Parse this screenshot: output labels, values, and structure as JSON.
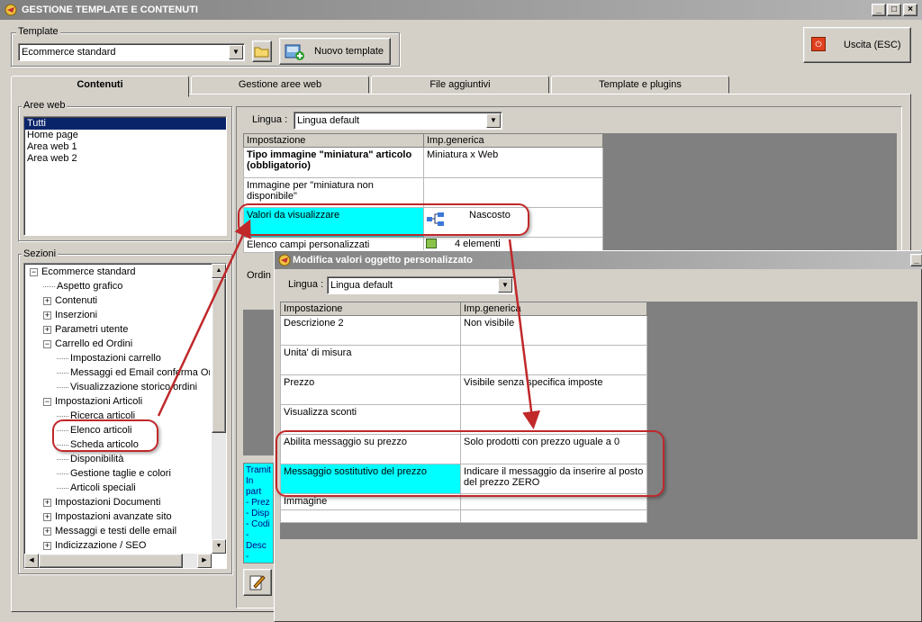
{
  "window": {
    "title": "GESTIONE TEMPLATE E CONTENUTI"
  },
  "template_group": {
    "label": "Template",
    "selected": "Ecommerce standard",
    "new_button": "Nuovo template"
  },
  "exit_button": "Uscita (ESC)",
  "tabs": [
    "Contenuti",
    "Gestione aree web",
    "File aggiuntivi",
    "Template e plugins"
  ],
  "aree_web": {
    "label": "Aree web",
    "items": [
      "Tutti",
      "Home page",
      "Area web 1",
      "Area web 2"
    ]
  },
  "sezioni": {
    "label": "Sezioni",
    "items": [
      {
        "text": "Ecommerce standard",
        "level": 0,
        "exp": "−"
      },
      {
        "text": "Aspetto grafico",
        "level": 1,
        "exp": ""
      },
      {
        "text": "Contenuti",
        "level": 1,
        "exp": "+"
      },
      {
        "text": "Inserzioni",
        "level": 1,
        "exp": "+"
      },
      {
        "text": "Parametri utente",
        "level": 1,
        "exp": "+"
      },
      {
        "text": "Carrello ed Ordini",
        "level": 1,
        "exp": "−"
      },
      {
        "text": "Impostazioni carrello",
        "level": 2,
        "exp": ""
      },
      {
        "text": "Messaggi ed Email conferma Ordini",
        "level": 2,
        "exp": ""
      },
      {
        "text": "Visualizzazione storico ordini",
        "level": 2,
        "exp": ""
      },
      {
        "text": "Impostazioni Articoli",
        "level": 1,
        "exp": "−"
      },
      {
        "text": "Ricerca articoli",
        "level": 2,
        "exp": ""
      },
      {
        "text": "Elenco articoli",
        "level": 2,
        "exp": ""
      },
      {
        "text": "Scheda articolo",
        "level": 2,
        "exp": ""
      },
      {
        "text": "Disponibilità",
        "level": 2,
        "exp": ""
      },
      {
        "text": "Gestione taglie e colori",
        "level": 2,
        "exp": ""
      },
      {
        "text": "Articoli speciali",
        "level": 2,
        "exp": ""
      },
      {
        "text": "Impostazioni Documenti",
        "level": 1,
        "exp": "+"
      },
      {
        "text": "Impostazioni avanzate sito",
        "level": 1,
        "exp": "+"
      },
      {
        "text": "Messaggi e testi delle email",
        "level": 1,
        "exp": "+"
      },
      {
        "text": "Indicizzazione / SEO",
        "level": 1,
        "exp": "+"
      }
    ]
  },
  "main": {
    "lingua_label": "Lingua :",
    "lingua_value": "Lingua default",
    "headers": [
      "Impostazione",
      "Imp.generica"
    ],
    "rows": [
      {
        "name": "Tipo immagine \"miniatura\" articolo (obbligatorio)",
        "value": "Miniatura x Web"
      },
      {
        "name": "Immagine per \"miniatura non disponibile\"",
        "value": ""
      },
      {
        "name": "Valori da visualizzare",
        "value": "Nascosto"
      },
      {
        "name": "Elenco campi personalizzati",
        "value": "4 elementi"
      },
      {
        "name": "Ordin",
        "value": ""
      }
    ],
    "info_lines": [
      "Tramit",
      "In part",
      "- Prez",
      "- Disp",
      "- Codi",
      "- Desc",
      "- Desc"
    ]
  },
  "dialog": {
    "title": "Modifica valori oggetto personalizzato",
    "lingua_label": "Lingua :",
    "lingua_value": "Lingua default",
    "headers": [
      "Impostazione",
      "Imp.generica"
    ],
    "rows": [
      {
        "name": "Descrizione 2",
        "value": "Non visibile"
      },
      {
        "name": "Unita' di misura",
        "value": ""
      },
      {
        "name": "Prezzo",
        "value": "Visibile senza specifica imposte"
      },
      {
        "name": "Visualizza sconti",
        "value": ""
      },
      {
        "name": "Abilita messaggio su prezzo",
        "value": "Solo prodotti con prezzo uguale a 0"
      },
      {
        "name": "Messaggio sostitutivo del prezzo",
        "value": "Indicare il messaggio da inserire al posto del prezzo ZERO"
      },
      {
        "name": "Immagine",
        "value": ""
      },
      {
        "name": "",
        "value": ""
      }
    ]
  }
}
